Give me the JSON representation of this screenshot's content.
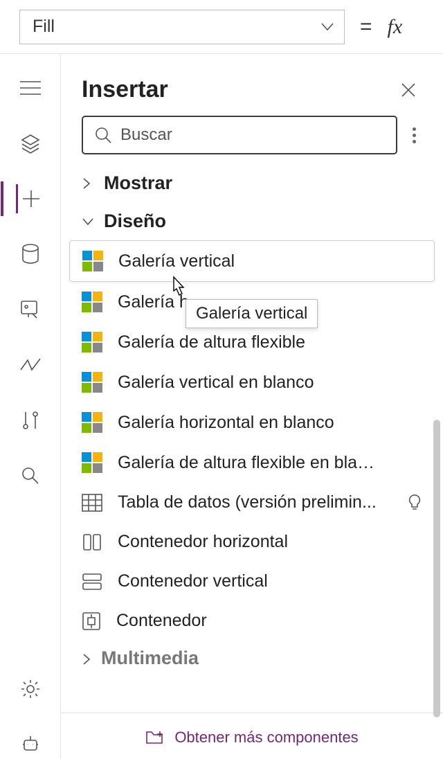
{
  "formula": {
    "property": "Fill",
    "equals": "="
  },
  "pane": {
    "title": "Insertar",
    "search_placeholder": "Buscar",
    "footer": "Obtener más componentes"
  },
  "categories": {
    "mostrar": "Mostrar",
    "diseno": "Diseño",
    "multimedia": "Multimedia"
  },
  "items": {
    "galeria_vertical": "Galería vertical",
    "galeria_horizontal": "Galería horizontal",
    "galeria_flex": "Galería de altura flexible",
    "galeria_v_blank": "Galería vertical en blanco",
    "galeria_h_blank": "Galería horizontal en blanco",
    "galeria_flex_blank": "Galería de altura flexible en blanco",
    "tabla_datos": "Tabla de datos (versión prelimin...",
    "cont_h": "Contenedor horizontal",
    "cont_v": "Contenedor vertical",
    "cont": "Contenedor"
  },
  "tooltip": "Galería vertical",
  "galeria_horizontal_truncated": "Galería h"
}
